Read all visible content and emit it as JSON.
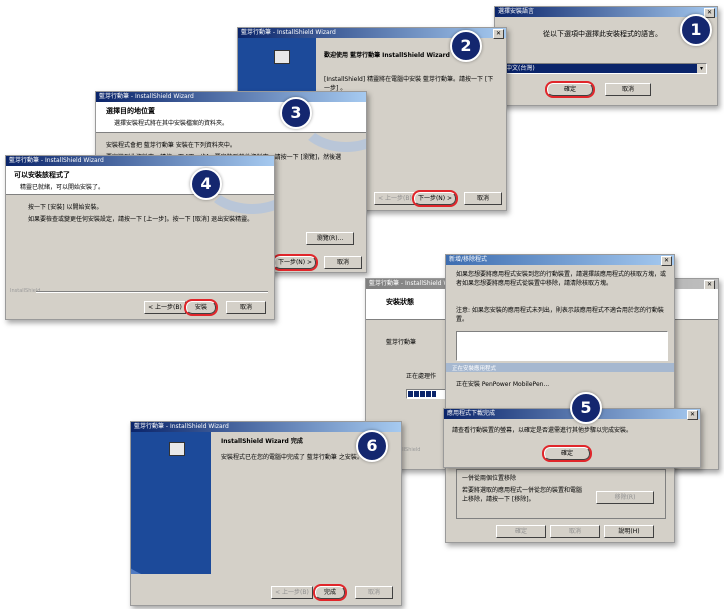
{
  "step_numbers": [
    "1",
    "2",
    "3",
    "4",
    "5",
    "6"
  ],
  "dialog1": {
    "title": "選擇安裝語言",
    "prompt": "從以下選項中選擇此安裝程式的語言。",
    "language_value": "中文(台灣)",
    "ok": "確定",
    "cancel": "取消"
  },
  "dialog2": {
    "title": "藍芽行動筆 - InstallShield Wizard",
    "welcome": "歡迎使用 藍芽行動筆 InstallShield Wizard",
    "body": "[InstallShield] 精靈將在電腦中安裝 藍芽行動筆。請按一下 [下一步] 。",
    "back": "< 上一步(B)",
    "next": "下一步(N) >",
    "cancel": "取消"
  },
  "dialog3": {
    "title": "藍芽行動筆 - InstallShield Wizard",
    "heading": "選擇目的地位置",
    "subheading": "選擇安裝程式將在其中安裝檔案的資料夾。",
    "line1": "安裝程式會把 藍芽行動筆 安裝在下列資料夾中。",
    "line2": "要安裝到此資料夾，請按一下 [下一步]。要安裝到其他資料夾，請按一下 [瀏覽]，然後選擇其他資料夾。",
    "browse": "瀏覽(R)...",
    "next": "下一步(N) >",
    "cancel": "取消"
  },
  "dialog4": {
    "title": "藍芽行動筆 - InstallShield Wizard",
    "heading": "可以安裝該程式了",
    "subheading": "精靈已就緒，可以開始安裝了。",
    "line1": "按一下 [安裝] 以開始安裝。",
    "line2": "如果要檢查或變更任何安裝設定，請按一下 [上一步]。按一下 [取消] 退出安裝精靈。",
    "footer": "InstallShield",
    "back": "< 上一步(B)",
    "install": "安裝",
    "cancel": "取消"
  },
  "dialog5": {
    "bg_title": "藍芽行動筆 - InstallShield Wizard",
    "bg_heading": "安裝狀態",
    "bg_line": "藍芽行動筆",
    "bg_status": "正在處理作",
    "bg_footer": "InstallShield",
    "bg_cancel": "取消",
    "add_remove_title": "新增/移除程式",
    "add_remove_p1": "如果您想要將應用程式安裝到您的行動裝置，請選擇該應用程式的核取方塊，或者如果您想要將應用程式從裝置中移除，請清除核取方塊。",
    "add_remove_p2": "注意: 如果您安裝的應用程式未列出，則表示該應用程式不適合用於您的行動裝置。",
    "installing_section": "正在安裝應用程式",
    "installing_text": "正在安裝 PenPower MobilePen...",
    "msg_title": "應用程式下載完成",
    "msg_text": "請查看行動裝置的螢幕，以確定是否還需進行其他步驟以完成安裝。",
    "msg_ok": "確定",
    "group_title": "一併從兩個位置移除",
    "group_text": "若要將選取的應用程式一併從您的裝置和電腦上移除，請按一下 [移除]。",
    "remove": "移除(R)",
    "ok": "確定",
    "cancel": "取消",
    "help": "說明(H)"
  },
  "dialog6": {
    "title": "藍芽行動筆 - InstallShield Wizard",
    "heading": "InstallShield Wizard 完成",
    "body": "安裝程式已在您的電腦中完成了 藍芽行動筆 之安裝。",
    "back": "< 上一步(B)",
    "finish": "完成",
    "cancel": "取消"
  },
  "colors": {
    "highlight": "#e0262b",
    "badge": "#14276f",
    "titlebar": "#0a246a"
  }
}
